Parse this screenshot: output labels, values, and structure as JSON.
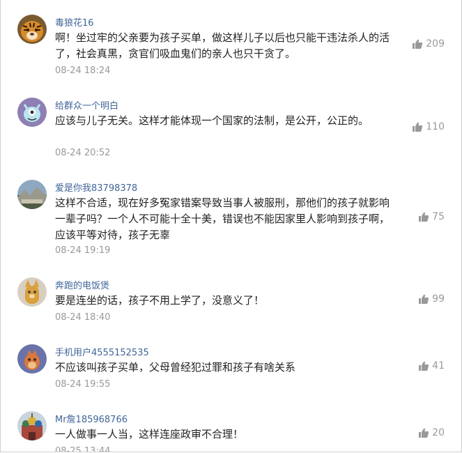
{
  "comments": [
    {
      "username": "毒狼花16",
      "text": "啊！坐过牢的父亲要为孩子买单，做这样儿子以后也只能干违法杀人的活了，社会真黑，贪官们吸血鬼们的亲人也只干贪了。",
      "time": "08-24 18:24",
      "likes": "209",
      "avatar_icon": "tiger-avatar-icon"
    },
    {
      "username": "给群众一个明白",
      "text": "应该与儿子无关。这样才能体现一个国家的法制，是公开，公正的。",
      "time": "08-24 20:52",
      "likes": "110",
      "avatar_icon": "cartoon-creature-avatar-icon"
    },
    {
      "username": "爱是你我83798378",
      "text": "这样不合适，现在好多冤家错案导致当事人被服刑，那他们的孩子就影响一辈子吗？一个人不可能十全十美，错误也不能因家里人影响到孩子啊，应该平等对待，孩子无辜",
      "time": "08-24 19:19",
      "likes": "75",
      "avatar_icon": "landscape-avatar-icon"
    },
    {
      "username": "奔跑的电饭煲",
      "text": "要是连坐的话，孩子不用上学了，没意义了！",
      "time": "08-24 18:40",
      "likes": "99",
      "avatar_icon": "cartoon-animal-avatar-icon"
    },
    {
      "username": "手机用户4555152535",
      "text": "不应该叫孩子买单，父母曾经犯过罪和孩子有啥关系",
      "time": "08-24 19:55",
      "likes": "41",
      "avatar_icon": "cartoon-bird-avatar-icon"
    },
    {
      "username": "Mr詹185968766",
      "text": "一人做事一人当，这样连座政审不合理！",
      "time": "08-25 13:44",
      "likes": "20",
      "avatar_icon": "cathedral-avatar-icon"
    }
  ],
  "colors": {
    "username": "#406599",
    "text": "#222222",
    "meta": "#999999"
  }
}
